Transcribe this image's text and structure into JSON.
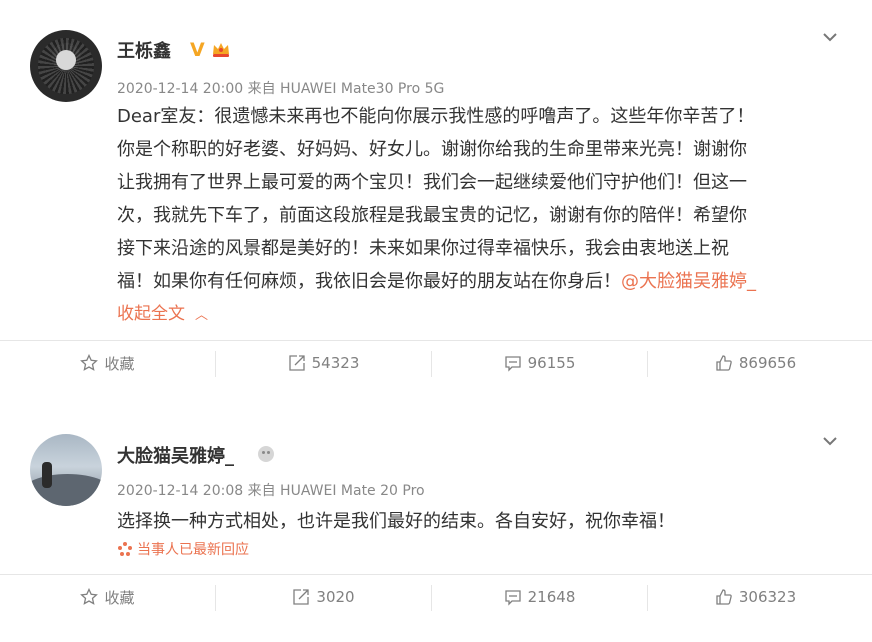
{
  "posts": [
    {
      "username": "王栎鑫",
      "meta": "2020-12-14 20:00 来自 HUAWEI Mate30 Pro 5G",
      "content_lines": [
        "Dear室友：很遗憾未来再也不能向你展示我性感的呼噜声了。这些年你辛苦了！",
        "你是个称职的好老婆、好妈妈、好女儿。谢谢你给我的生命里带来光亮！谢谢你",
        "让我拥有了世界上最可爱的两个宝贝！我们会一起继续爱他们守护他们！但这一",
        "次，我就先下车了，前面这段旅程是我最宝贵的记忆，谢谢有你的陪伴！希望你",
        "接下来沿途的风景都是美好的！未来如果你过得幸福快乐，我会由衷地送上祝",
        "福！如果你有任何麻烦，我依旧会是你最好的朋友站在你身后！"
      ],
      "mention": "@大脸猫吴雅婷_",
      "collapse_label": "收起全文",
      "actions": {
        "favorite": "收藏",
        "repost": "54323",
        "comment": "96155",
        "like": "869656"
      }
    },
    {
      "username": "大脸猫吴雅婷_",
      "meta": "2020-12-14 20:08 来自 HUAWEI Mate 20 Pro",
      "content": "选择换一种方式相处，也许是我们最好的结束。各自安好，祝你幸福！",
      "reply_note": "当事人已最新回应",
      "actions": {
        "favorite": "收藏",
        "repost": "3020",
        "comment": "21648",
        "like": "306323"
      }
    }
  ],
  "icons": {
    "verified": "v-badge-icon",
    "member": "crown-icon",
    "favorite": "star-icon",
    "repost": "repost-icon",
    "comment": "comment-icon",
    "like": "thumbs-up-icon",
    "menu": "chevron-down-icon"
  },
  "colors": {
    "accent": "#eb7350",
    "text": "#333333",
    "meta": "#888888",
    "badge": "#f5a623"
  }
}
